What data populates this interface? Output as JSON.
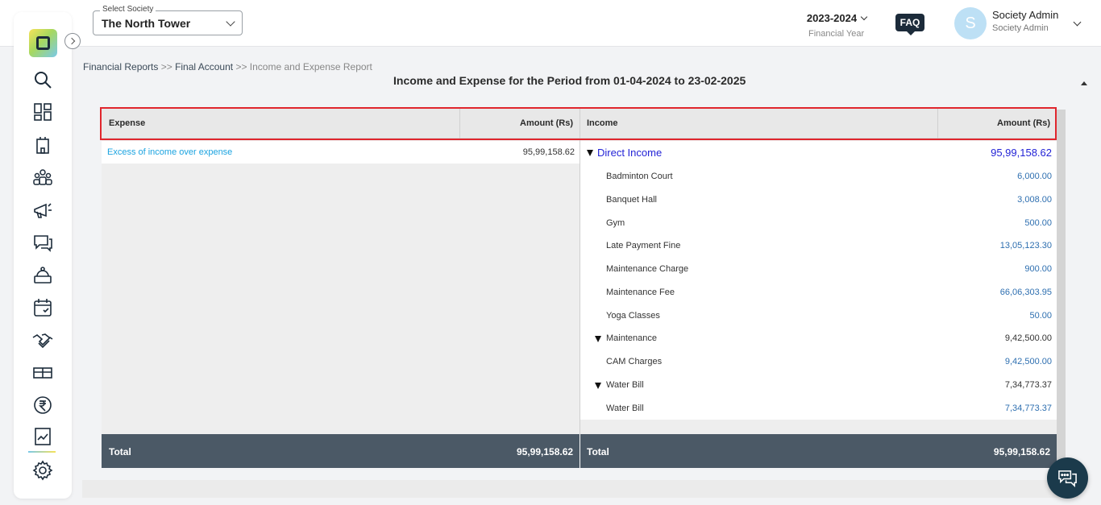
{
  "header": {
    "society_label": "Select Society",
    "society_value": "The North Tower",
    "financial_year": "2023-2024",
    "financial_year_label": "Financial Year",
    "faq": "FAQ",
    "avatar_initial": "S",
    "user_name": "Society Admin",
    "user_role": "Society Admin"
  },
  "sidebar": {
    "icons": [
      "search-icon",
      "dashboard-icon",
      "building-icon",
      "members-icon",
      "announcement-icon",
      "chat-icon",
      "helpdesk-icon",
      "calendar-icon",
      "handshake-icon",
      "amenities-icon",
      "rupee-icon",
      "reports-icon",
      "settings-icon"
    ],
    "accent_colors": [
      "#79c9e9",
      "#f6e25a",
      "#a6d85f"
    ]
  },
  "breadcrumb": {
    "item1": "Financial Reports",
    "sep1": " >> ",
    "item2": "Final Account",
    "sep2": " >> ",
    "item3": "Income and Expense Report"
  },
  "report": {
    "title": "Income and Expense for the Period from 01-04-2024 to 23-02-2025",
    "expense_header": "Expense",
    "expense_amount_header": "Amount (Rs)",
    "income_header": "Income",
    "income_amount_header": "Amount (Rs)",
    "expense_rows": [
      {
        "name": "Excess of income over expense",
        "amount": "95,99,158.62"
      }
    ],
    "income_rows": [
      {
        "name": "Direct Income",
        "amount": "95,99,158.62"
      },
      {
        "name": "Badminton Court",
        "amount": "6,000.00"
      },
      {
        "name": "Banquet Hall",
        "amount": "3,008.00"
      },
      {
        "name": "Gym",
        "amount": "500.00"
      },
      {
        "name": "Late Payment Fine",
        "amount": "13,05,123.30"
      },
      {
        "name": "Maintenance Charge",
        "amount": "900.00"
      },
      {
        "name": "Maintenance Fee",
        "amount": "66,06,303.95"
      },
      {
        "name": "Yoga Classes",
        "amount": "50.00"
      },
      {
        "name": "Maintenance",
        "amount": "9,42,500.00"
      },
      {
        "name": "CAM Charges",
        "amount": "9,42,500.00"
      },
      {
        "name": "Water Bill",
        "amount": "7,34,773.37"
      },
      {
        "name": "Water Bill",
        "amount": "7,34,773.37"
      }
    ],
    "total_label_left": "Total",
    "total_amount_left": "95,99,158.62",
    "total_label_right": "Total",
    "total_amount_right": "95,99,158.62"
  },
  "colors": {
    "highlight_border": "#e0262d",
    "total_bar": "#4b5966",
    "link_blue": "#1aa3e0",
    "group_blue": "#2323d6",
    "amount_blue": "#2e6fb0"
  }
}
